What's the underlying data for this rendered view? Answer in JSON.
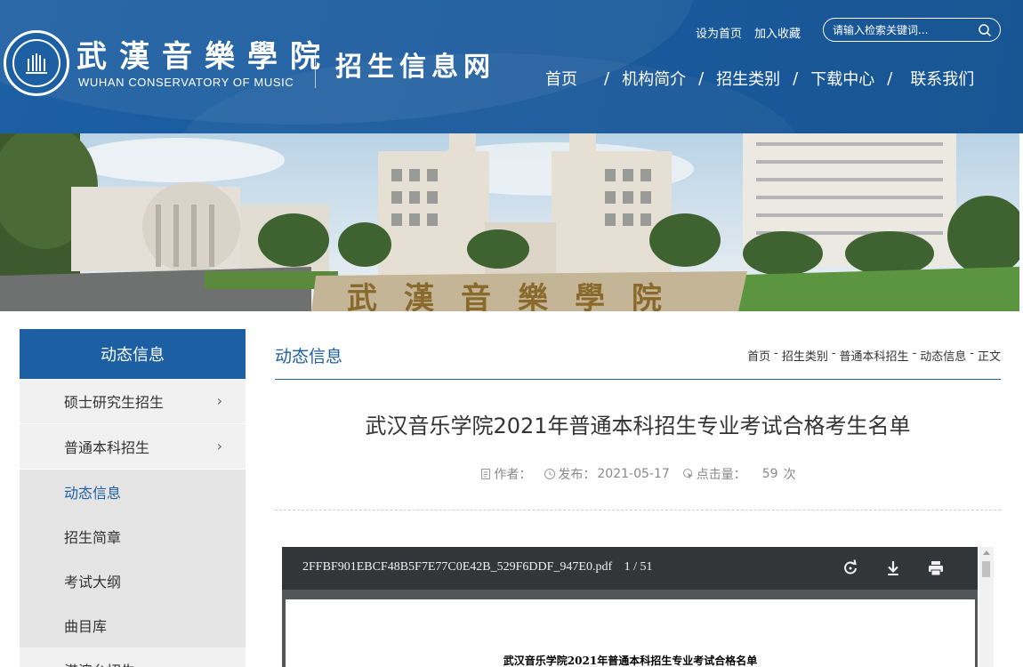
{
  "header": {
    "logo_cn": "武漢音樂學院",
    "logo_en": "WUHAN CONSERVATORY OF MUSIC",
    "site_name": "招生信息网",
    "top_links": [
      "设为首页",
      "加入收藏"
    ],
    "search_placeholder": "请输入检索关键词...",
    "nav": [
      "首页",
      "机构简介",
      "招生类别",
      "下载中心",
      "联系我们"
    ]
  },
  "banner": {
    "inscription": "武漢音樂學院"
  },
  "sidebar": {
    "title": "动态信息",
    "items": [
      {
        "label": "硕士研究生招生",
        "chevron": "›"
      },
      {
        "label": "普通本科招生",
        "chevron": "›"
      }
    ],
    "sub_items": [
      "动态信息",
      "招生简章",
      "考试大纲",
      "曲目库"
    ],
    "next_item": {
      "label": "港澳台招生",
      "chevron": "›"
    }
  },
  "content": {
    "section_title": "动态信息",
    "breadcrumb": [
      "首页",
      "招生类别",
      "普通本科招生",
      "动态信息",
      "正文"
    ],
    "article_title": "武汉音乐学院2021年普通本科招生专业考试合格考生名单",
    "meta": {
      "author_label": "作者：",
      "publish_label": "发布：",
      "publish_date": "2021-05-17",
      "views_label": "点击量：",
      "views_count": "59",
      "views_unit": "次"
    }
  },
  "pdf_viewer": {
    "filename": "2FFBF901EBCF48B5F7E77C0E42B_529F6DDF_947E0.pdf",
    "pages": "1 / 51",
    "page_heading": "武汉音乐学院2021年普通本科招生专业考试合格名单"
  },
  "colors": {
    "brand_blue": "#1d5fa3",
    "sidebar_bg": "#f1f1f1",
    "pdf_toolbar": "#323639"
  }
}
